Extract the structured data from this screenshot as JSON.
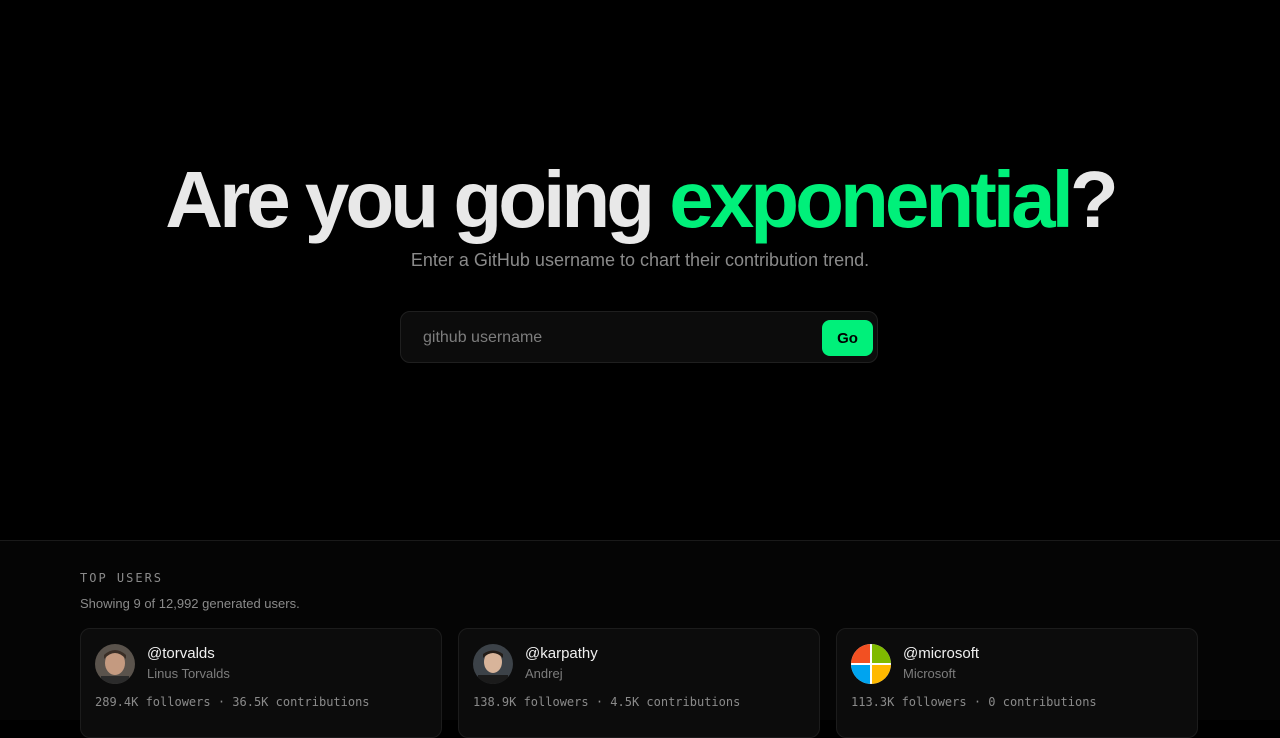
{
  "hero": {
    "headline_main": "Are you going ",
    "headline_accent": "exponential",
    "headline_end": "?",
    "subtitle": "Enter a GitHub username to chart their contribution trend."
  },
  "search": {
    "placeholder": "github username",
    "value": "",
    "go_label": "Go"
  },
  "top_users": {
    "label": "TOP USERS",
    "note": "Showing 9 of 12,992 generated users.",
    "cards": [
      {
        "handle": "@torvalds",
        "name": "Linus Torvalds",
        "stats": "289.4K followers · 36.5K contributions"
      },
      {
        "handle": "@karpathy",
        "name": "Andrej",
        "stats": "138.9K followers · 4.5K contributions"
      },
      {
        "handle": "@microsoft",
        "name": "Microsoft",
        "stats": "113.3K followers · 0 contributions"
      }
    ]
  },
  "colors": {
    "accent": "#00f07a",
    "background": "#000000"
  }
}
